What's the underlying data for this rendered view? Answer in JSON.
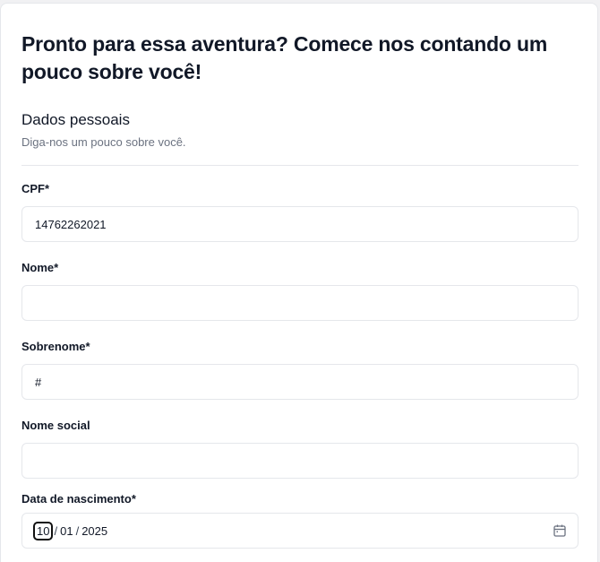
{
  "form": {
    "headline": "Pronto para essa aventura? Comece nos contando um pouco sobre você!",
    "section_title": "Dados pessoais",
    "section_subtitle": "Diga-nos um pouco sobre você."
  },
  "fields": {
    "cpf": {
      "label": "CPF*",
      "value": "14762262021"
    },
    "nome": {
      "label": "Nome*",
      "value": ""
    },
    "sobrenome": {
      "label": "Sobrenome*",
      "value": "#"
    },
    "nome_social": {
      "label": "Nome social",
      "value": ""
    },
    "data_nascimento": {
      "label": "Data de nascimento*",
      "day": "10",
      "month": "01",
      "year": "2025",
      "separator": "/"
    }
  },
  "icons": {
    "calendar": "calendar-icon"
  },
  "colors": {
    "border": "#e5e7eb",
    "muted_text": "#6b7280",
    "text": "#111827"
  }
}
